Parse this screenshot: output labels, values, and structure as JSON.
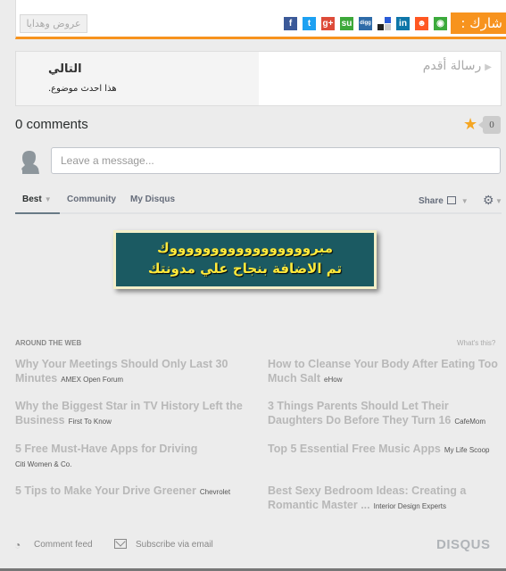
{
  "share_bar": {
    "label": "شارك :",
    "offers_button": "عروض وهدايا",
    "icons": [
      {
        "name": "kik-icon",
        "glyph": "◉",
        "color": "#3caa3c"
      },
      {
        "name": "reddit-icon",
        "glyph": "☻",
        "color": "#ff5722"
      },
      {
        "name": "linkedin-icon",
        "glyph": "in",
        "color": "#0e76a8"
      },
      {
        "name": "delicious-icon",
        "glyph": "",
        "color": "#ffffff"
      },
      {
        "name": "digg-icon",
        "glyph": "digg",
        "color": "#2e6ba8"
      },
      {
        "name": "stumbleupon-icon",
        "glyph": "su",
        "color": "#3da83a"
      },
      {
        "name": "google-plus-icon",
        "glyph": "g+",
        "color": "#dd4b39"
      },
      {
        "name": "twitter-icon",
        "glyph": "t",
        "color": "#1da1f2"
      },
      {
        "name": "facebook-icon",
        "glyph": "f",
        "color": "#3b5998"
      }
    ]
  },
  "post_nav": {
    "older_label": "رسالة أقدم",
    "newer_title": "التالي",
    "newer_subtitle": "هذا احدث موضوع."
  },
  "disqus": {
    "comments_count": "0 comments",
    "recommend_count": "0",
    "message_placeholder": "Leave a message...",
    "tabs": [
      {
        "label": "Best",
        "active": true
      },
      {
        "label": "Community",
        "active": false
      },
      {
        "label": "My Disqus",
        "active": false
      }
    ],
    "share_label": "Share"
  },
  "banner": {
    "line1": "مبروووووووووووووووووك",
    "line2": "تم الاضافة بنجاح علي مدونتك"
  },
  "around_the_web": {
    "title": "AROUND THE WEB",
    "whats_this": "What's this?",
    "items": [
      {
        "title": "Why Your Meetings Should Only Last 30 Minutes",
        "source": "AMEX Open Forum"
      },
      {
        "title": "How to Cleanse Your Body After Eating Too Much Salt",
        "source": "eHow"
      },
      {
        "title": "Why the Biggest Star in TV History Left the Business",
        "source": "First To Know"
      },
      {
        "title": "3 Things Parents Should Let Their Daughters Do Before They Turn 16",
        "source": "CafeMom"
      },
      {
        "title": "5 Free Must-Have Apps for Driving",
        "source": "Citi Women & Co."
      },
      {
        "title": "Top 5 Essential Free Music Apps",
        "source": "My Life Scoop"
      },
      {
        "title": "5 Tips to Make Your Drive Greener",
        "source": "Chevrolet"
      },
      {
        "title": "Best Sexy Bedroom Ideas: Creating a Romantic Master ...",
        "source": "Interior Design Experts"
      }
    ]
  },
  "footer": {
    "comment_feed": "Comment feed",
    "subscribe": "Subscribe via email",
    "logo": "DISQUS"
  }
}
